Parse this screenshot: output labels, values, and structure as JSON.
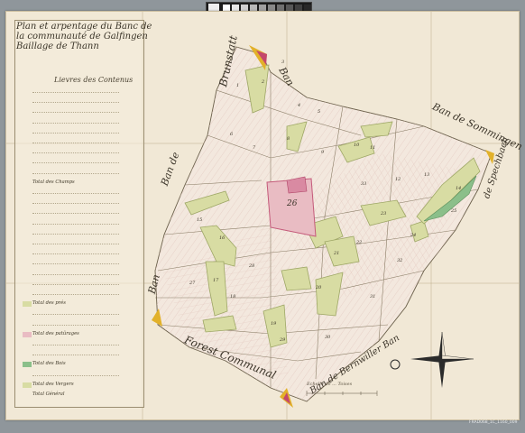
{
  "title_lines": [
    "Plan et arpentage du Banc de",
    "la communauté de Galfingen",
    "Baillage de Thann"
  ],
  "legend_subtitle": "Lievres des Contenus",
  "legend_rows": [
    {
      "label": "",
      "kind": "row"
    },
    {
      "label": "",
      "kind": "row"
    },
    {
      "label": "",
      "kind": "row"
    },
    {
      "label": "",
      "kind": "row"
    },
    {
      "label": "",
      "kind": "row"
    },
    {
      "label": "",
      "kind": "row"
    },
    {
      "label": "",
      "kind": "row"
    },
    {
      "label": "",
      "kind": "row"
    },
    {
      "label": "",
      "kind": "row"
    },
    {
      "label": "Total des Champs",
      "kind": "total"
    },
    {
      "label": "",
      "kind": "row"
    },
    {
      "label": "",
      "kind": "row"
    },
    {
      "label": "",
      "kind": "row"
    },
    {
      "label": "",
      "kind": "row"
    },
    {
      "label": "",
      "kind": "row"
    },
    {
      "label": "",
      "kind": "row"
    },
    {
      "label": "",
      "kind": "row"
    },
    {
      "label": "",
      "kind": "row"
    },
    {
      "label": "",
      "kind": "row"
    },
    {
      "label": "",
      "kind": "row"
    },
    {
      "label": "",
      "kind": "row"
    },
    {
      "label": "Total des prés",
      "kind": "total"
    },
    {
      "label": "",
      "kind": "row"
    },
    {
      "label": "",
      "kind": "row"
    },
    {
      "label": "Total des patûrages",
      "kind": "total"
    },
    {
      "label": "",
      "kind": "row"
    },
    {
      "label": "",
      "kind": "row"
    },
    {
      "label": "Total des Bois",
      "kind": "total"
    },
    {
      "label": "",
      "kind": "row"
    },
    {
      "label": "Total des Vergers",
      "kind": "total"
    },
    {
      "label": "Total Général",
      "kind": "total"
    }
  ],
  "map_labels": {
    "north_text": "Brunstatt",
    "north_text2": "Ban",
    "east_text": "Ban de Sommingen",
    "east_text2": "de Spechbach",
    "west_text": "Ban de",
    "west_text2": "Ban",
    "south_text": "Forest Communal",
    "south_text2": "Ban de Bernwiller Ban",
    "village_number": "26"
  },
  "parcel_numbers": [
    "1",
    "2",
    "3",
    "4",
    "5",
    "6",
    "7",
    "8",
    "9",
    "10",
    "11",
    "12",
    "13",
    "14",
    "15",
    "16",
    "17",
    "18",
    "19",
    "20",
    "21",
    "22",
    "23",
    "24",
    "25",
    "27",
    "28",
    "29",
    "30",
    "31",
    "32",
    "33"
  ],
  "scale_caption": "Echelle de ... Toises",
  "archive_ref": "FRAD068_1C_1160_009",
  "colors": {
    "paper": "#f1e8d6",
    "field": "#f2e6dc",
    "meadow": "#d8dca3",
    "meadow_border": "#9ea766",
    "village": "#e9bcc3",
    "village_border": "#c45a7a",
    "forest_green": "#8bbf8a",
    "border_accent": "#e2b12a",
    "border_accent2": "#c4486b",
    "ink": "#3a3428"
  },
  "calibration_colors": [
    "#ffffff",
    "#e8e8e8",
    "#d0d0d0",
    "#b8b8b8",
    "#a0a0a0",
    "#888888",
    "#707070",
    "#585858",
    "#404040",
    "#282828"
  ]
}
